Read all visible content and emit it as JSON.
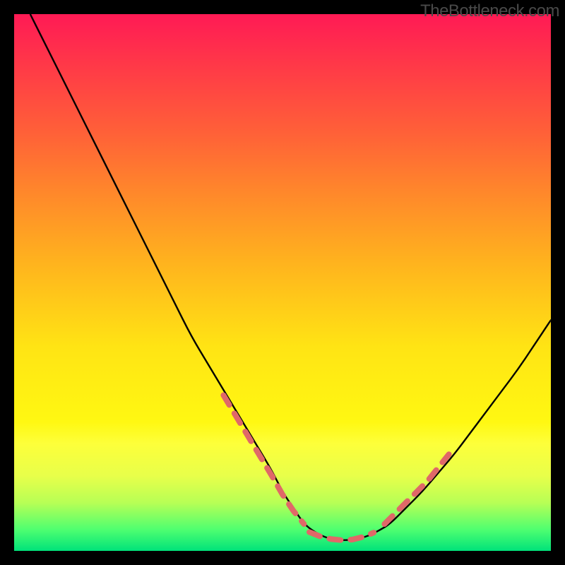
{
  "watermark": "TheBottleneck.com",
  "colors": {
    "outer_frame": "#000000",
    "curve": "#000000",
    "highlight_dash": "#e06868"
  },
  "chart_data": {
    "type": "line",
    "title": "",
    "xlabel": "",
    "ylabel": "",
    "xlim": [
      0,
      100
    ],
    "ylim": [
      0,
      100
    ],
    "grid": false,
    "series": [
      {
        "name": "bottleneck-curve",
        "x": [
          3,
          6,
          9,
          12,
          15,
          18,
          21,
          24,
          27,
          30,
          33,
          36,
          39,
          42,
          45,
          48,
          50,
          52,
          54,
          56,
          58,
          60,
          62,
          64,
          66,
          68,
          70,
          73,
          76,
          79,
          82,
          85,
          88,
          91,
          94,
          97,
          100
        ],
        "values": [
          100,
          94,
          88,
          82,
          76,
          70,
          64,
          58,
          52,
          46,
          40,
          35,
          30,
          25,
          20,
          15,
          11,
          8,
          5,
          3.5,
          2.5,
          2,
          2,
          2.2,
          2.8,
          3.8,
          5,
          8,
          11,
          14.5,
          18,
          22,
          26,
          30,
          34,
          38.5,
          43
        ]
      }
    ],
    "highlight_segments": [
      {
        "name": "left-arm-red-dashes",
        "x": [
          39,
          42,
          45,
          48,
          50,
          52,
          54
        ],
        "values": [
          29,
          24,
          19,
          14,
          10.5,
          7.5,
          5
        ]
      },
      {
        "name": "trough-red-dashes",
        "x": [
          55,
          57,
          59,
          61,
          63,
          65,
          67
        ],
        "values": [
          3.5,
          2.7,
          2.2,
          2.0,
          2.1,
          2.6,
          3.4
        ]
      },
      {
        "name": "right-arm-red-dashes",
        "x": [
          69,
          71,
          73,
          75,
          77,
          79,
          81
        ],
        "values": [
          5,
          7,
          9,
          11,
          13,
          15.5,
          18
        ]
      }
    ]
  }
}
